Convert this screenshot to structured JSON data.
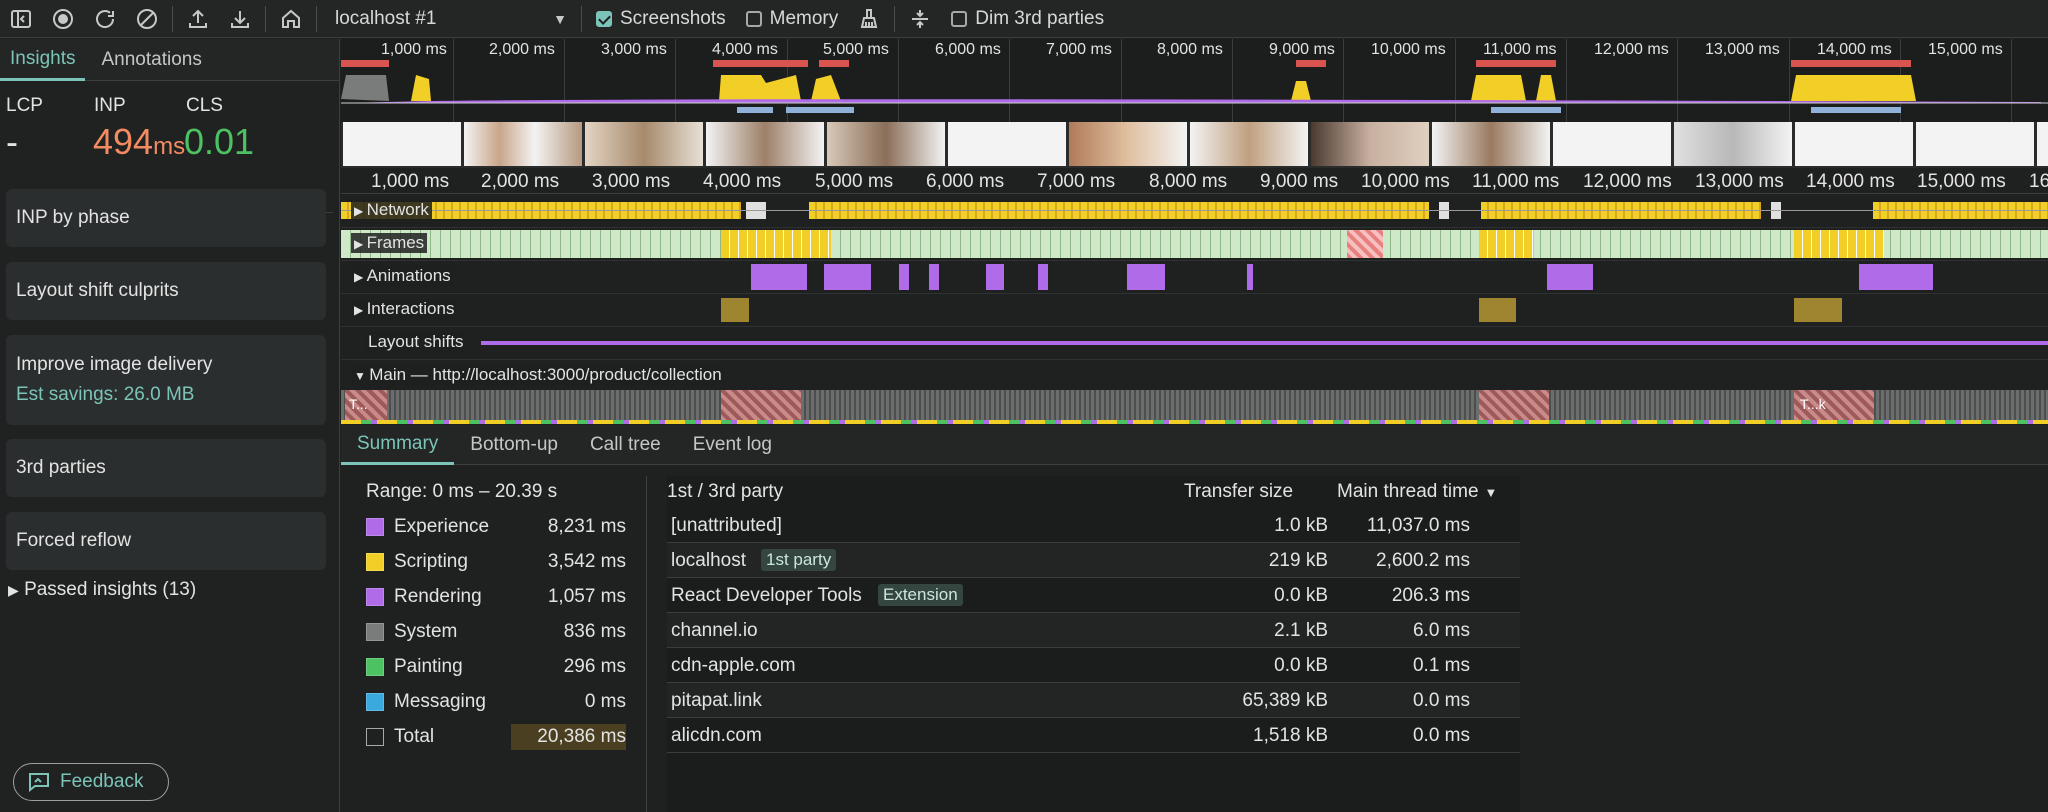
{
  "toolbar": {
    "target": "localhost #1",
    "screenshots_label": "Screenshots",
    "memory_label": "Memory",
    "dim_label": "Dim 3rd parties"
  },
  "sidebar": {
    "tabs": [
      "Insights",
      "Annotations"
    ],
    "metrics": {
      "lcp_label": "LCP",
      "lcp_value": "-",
      "inp_label": "INP",
      "inp_value": "494",
      "inp_unit": "ms",
      "cls_label": "CLS",
      "cls_value": "0.01"
    },
    "insights": [
      {
        "label": "INP by phase"
      },
      {
        "label": "Layout shift culprits"
      },
      {
        "label": "Improve image delivery",
        "sub": "Est savings: 26.0 MB"
      },
      {
        "label": "3rd parties"
      },
      {
        "label": "Forced reflow"
      }
    ],
    "passed": "Passed insights (13)",
    "feedback": "Feedback"
  },
  "overview": {
    "ticks": [
      "1,000 ms",
      "2,000 ms",
      "3,000 ms",
      "4,000 ms",
      "5,000 ms",
      "6,000 ms",
      "7,000 ms",
      "8,000 ms",
      "9,000 ms",
      "10,000 ms",
      "11,000 ms",
      "12,000 ms",
      "13,000 ms",
      "14,000 ms",
      "15,000 ms"
    ]
  },
  "ruler": {
    "ticks": [
      "1,000 ms",
      "2,000 ms",
      "3,000 ms",
      "4,000 ms",
      "5,000 ms",
      "6,000 ms",
      "7,000 ms",
      "8,000 ms",
      "9,000 ms",
      "10,000 ms",
      "11,000 ms",
      "12,000 ms",
      "13,000 ms",
      "14,000 ms",
      "15,000 ms",
      "16"
    ]
  },
  "tracks": {
    "network": "Network",
    "frames": "Frames",
    "animations": "Animations",
    "interactions": "Interactions",
    "layout_shifts": "Layout shifts",
    "main": "Main — http://localhost:3000/product/collection",
    "main_labels": [
      "T...",
      "T...k"
    ]
  },
  "bottom": {
    "tabs": [
      "Summary",
      "Bottom-up",
      "Call tree",
      "Event log"
    ],
    "range": "Range: 0 ms – 20.39 s",
    "categories": [
      {
        "name": "Experience",
        "value": "8,231 ms",
        "color": "#b06be9"
      },
      {
        "name": "Scripting",
        "value": "3,542 ms",
        "color": "#f2cf27"
      },
      {
        "name": "Rendering",
        "value": "1,057 ms",
        "color": "#b06be9"
      },
      {
        "name": "System",
        "value": "836 ms",
        "color": "#7a7c7c"
      },
      {
        "name": "Painting",
        "value": "296 ms",
        "color": "#4cc262"
      },
      {
        "name": "Messaging",
        "value": "0 ms",
        "color": "#3aa9dd"
      },
      {
        "name": "Total",
        "value": "20,386 ms",
        "color": "transparent"
      }
    ],
    "third_party": {
      "col_party": "1st / 3rd party",
      "col_transfer": "Transfer size",
      "col_main": "Main thread time",
      "rows": [
        {
          "name": "[unattributed]",
          "badge": "",
          "transfer": "1.0 kB",
          "time": "11,037.0 ms"
        },
        {
          "name": "localhost",
          "badge": "1st party",
          "transfer": "219 kB",
          "time": "2,600.2 ms"
        },
        {
          "name": "React Developer Tools",
          "badge": "Extension",
          "transfer": "0.0 kB",
          "time": "206.3 ms"
        },
        {
          "name": "channel.io",
          "badge": "",
          "transfer": "2.1 kB",
          "time": "6.0 ms"
        },
        {
          "name": "cdn-apple.com",
          "badge": "",
          "transfer": "0.0 kB",
          "time": "0.1 ms"
        },
        {
          "name": "pitapat.link",
          "badge": "",
          "transfer": "65,389 kB",
          "time": "0.0 ms"
        },
        {
          "name": "alicdn.com",
          "badge": "",
          "transfer": "1,518 kB",
          "time": "0.0 ms"
        }
      ]
    }
  },
  "colors": {
    "accent": "#7cc4b8",
    "inp": "#f28b62",
    "cls": "#4cc262",
    "scripting": "#f2cf27",
    "animation": "#b06be9",
    "interaction": "#a08530"
  }
}
